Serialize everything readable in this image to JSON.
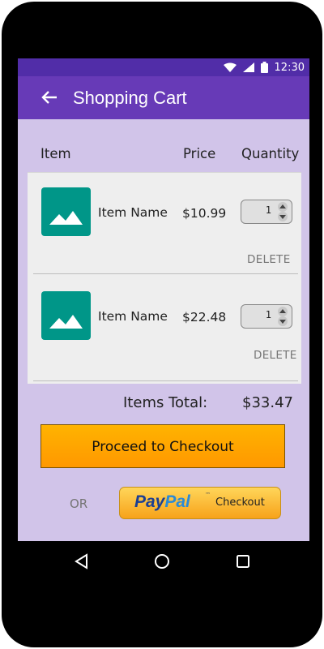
{
  "status_bar": {
    "time": "12:30",
    "icons": [
      "wifi-icon",
      "signal-icon",
      "battery-icon"
    ]
  },
  "app_bar": {
    "back_icon": "arrow-left-icon",
    "title": "Shopping Cart"
  },
  "columns": {
    "item": "Item",
    "price": "Price",
    "quantity": "Quantity"
  },
  "cart_items": [
    {
      "name": "Item Name",
      "price": "$10.99",
      "quantity": "1",
      "delete_label": "DELETE",
      "thumbnail_icon": "image-placeholder-icon"
    },
    {
      "name": "Item Name",
      "price": "$22.48",
      "quantity": "1",
      "delete_label": "DELETE",
      "thumbnail_icon": "image-placeholder-icon"
    }
  ],
  "totals": {
    "label": "Items Total:",
    "value": "$33.47"
  },
  "checkout": {
    "button_label": "Proceed to Checkout",
    "or_label": "OR",
    "paypal_part1": "Pay",
    "paypal_part2": "Pal",
    "paypal_tm": "™",
    "paypal_checkout_label": "Checkout"
  },
  "nav": {
    "back_icon": "nav-back-triangle-icon",
    "home_icon": "nav-home-circle-icon",
    "recents_icon": "nav-recents-square-icon"
  },
  "colors": {
    "status_bar": "#512da8",
    "app_bar": "#673ab7",
    "screen_background": "#d1c4e9",
    "thumbnail": "#009688",
    "checkout_button": "#ffa000"
  }
}
